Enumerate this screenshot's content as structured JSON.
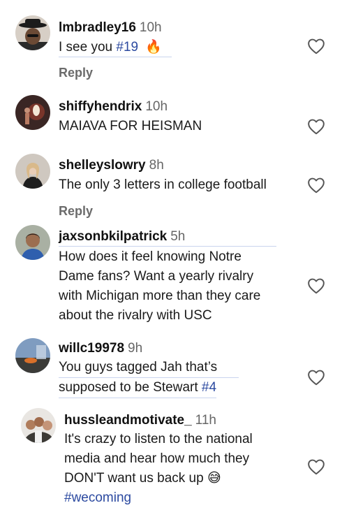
{
  "comments": [
    {
      "username": "lmbradley16",
      "time": "10h",
      "text": "I see you ",
      "tag": "#19",
      "emoji": "🔥",
      "reply_label": "Reply"
    },
    {
      "username": "shiffyhendrix",
      "time": "10h",
      "text": "MAIAVA FOR HEISMAN"
    },
    {
      "username": "shelleyslowry",
      "time": "8h",
      "text": "The only 3 letters in college football",
      "reply_label": "Reply"
    },
    {
      "username": "jaxsonbkilpatrick",
      "time": "5h",
      "lines": [
        "How does it feel knowing Notre",
        "Dame fans? Want a yearly rivalry",
        "with Michigan more than they care",
        "about the rivalry with USC"
      ]
    },
    {
      "username": "willc19978",
      "time": "9h",
      "line1": "You guys tagged Jah that’s",
      "line2": "supposed to be Stewart ",
      "tag": "#4"
    },
    {
      "username": "hussleandmotivate_",
      "time": "11h",
      "lines": [
        "It's crazy to listen to the national",
        "media and hear how much they",
        "DON'T want us back up "
      ],
      "emoji": "😅",
      "tag": "#wecoming"
    }
  ],
  "icons": {
    "like": "heart-outline-icon"
  }
}
